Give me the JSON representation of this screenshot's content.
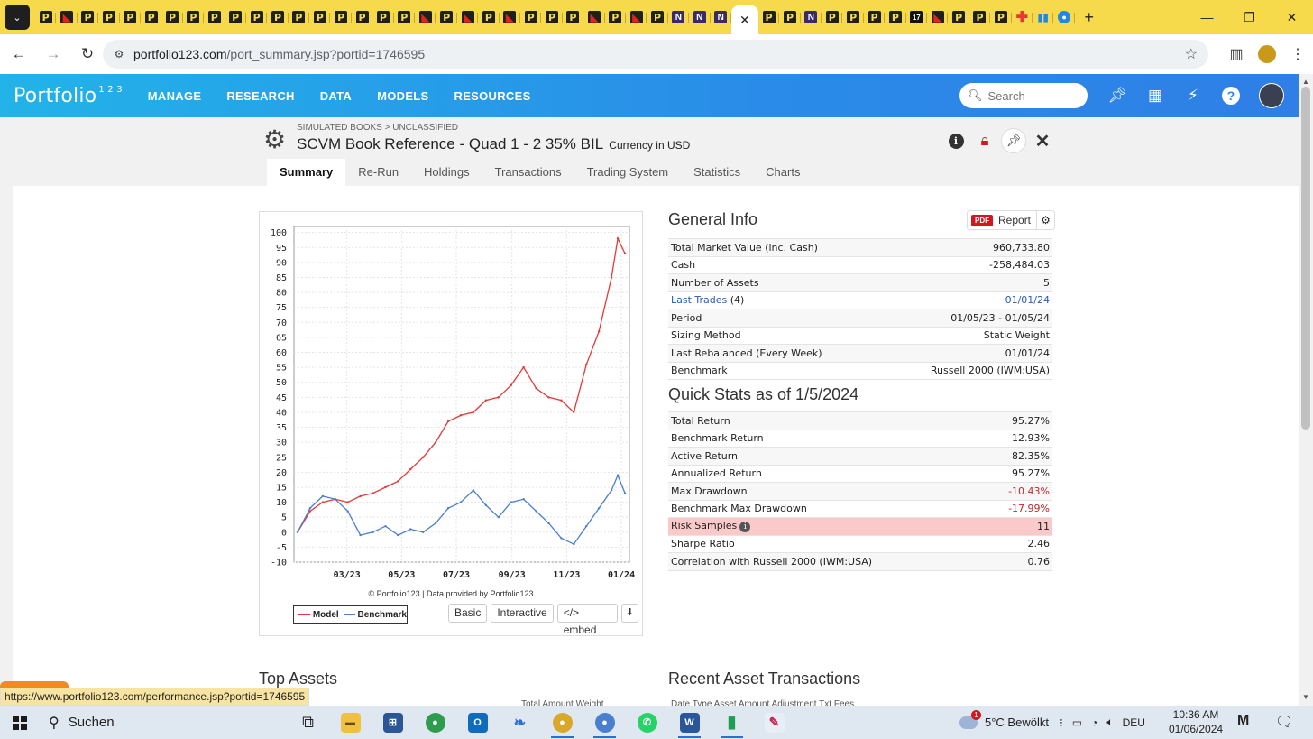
{
  "browser": {
    "tab_favicons": [
      "p",
      "red",
      "p",
      "p",
      "p",
      "p",
      "p",
      "p",
      "p",
      "p",
      "p",
      "p",
      "p",
      "p",
      "p",
      "p",
      "p",
      "p",
      "red",
      "p",
      "red",
      "p",
      "red",
      "p",
      "p",
      "p",
      "red",
      "p",
      "red",
      "p",
      "n",
      "n",
      "n",
      "active",
      "p",
      "p",
      "n",
      "p",
      "p",
      "p",
      "p",
      "17",
      "red",
      "p",
      "p",
      "p",
      "plus",
      "bars",
      "blue"
    ],
    "active_tab_close": "✕",
    "new_tab": "+",
    "url_host": "portfolio123.com",
    "url_path": "/port_summary.jsp?portid=1746595",
    "status_url": "https://www.portfolio123.com/performance.jsp?portid=1746595"
  },
  "site": {
    "logo_text": "Portfolio",
    "logo_sup": "1 2 3",
    "nav": [
      "MANAGE",
      "RESEARCH",
      "DATA",
      "MODELS",
      "RESOURCES"
    ],
    "search_placeholder": "Search"
  },
  "book": {
    "breadcrumb": "SIMULATED BOOKS > UNCLASSIFIED",
    "title": "SCVM Book Reference - Quad 1 - 2 35% BIL",
    "currency": "Currency in USD",
    "tabs": [
      "Summary",
      "Re-Run",
      "Holdings",
      "Transactions",
      "Trading System",
      "Statistics",
      "Charts"
    ],
    "active_tab": "Summary"
  },
  "chart_card": {
    "credit": "© Portfolio123 | Data provided by Portfolio123",
    "legend_model": "Model",
    "legend_benchmark": "Benchmark",
    "btn_basic": "Basic",
    "btn_interactive": "Interactive",
    "btn_embed": "</> embed"
  },
  "chart_data": {
    "type": "line",
    "x_ticks": [
      "03/23",
      "05/23",
      "07/23",
      "09/23",
      "11/23",
      "01/24"
    ],
    "y_ticks": [
      100,
      95,
      90,
      85,
      80,
      75,
      70,
      65,
      60,
      55,
      50,
      45,
      40,
      35,
      30,
      25,
      20,
      15,
      10,
      5,
      0,
      -5,
      -10
    ],
    "ylim": [
      -10,
      102
    ],
    "grid": true,
    "legend_position": "bottom-left",
    "series": [
      {
        "name": "Model",
        "color": "#e53935",
        "x": [
          "01/05/23",
          "01/19/23",
          "02/02/23",
          "02/16/23",
          "03/02/23",
          "03/16/23",
          "03/30/23",
          "04/13/23",
          "04/27/23",
          "05/11/23",
          "05/25/23",
          "06/08/23",
          "06/22/23",
          "07/06/23",
          "07/20/23",
          "08/03/23",
          "08/17/23",
          "08/31/23",
          "09/14/23",
          "09/28/23",
          "10/12/23",
          "10/26/23",
          "11/09/23",
          "11/23/23",
          "12/07/23",
          "12/21/23",
          "12/28/23",
          "01/05/24"
        ],
        "values": [
          0,
          7,
          10,
          11,
          10,
          12,
          13,
          15,
          17,
          21,
          25,
          30,
          37,
          39,
          40,
          44,
          45,
          49,
          55,
          48,
          45,
          44,
          40,
          56,
          67,
          85,
          98,
          93
        ]
      },
      {
        "name": "Benchmark",
        "color": "#4a7fd0",
        "x": [
          "01/05/23",
          "01/19/23",
          "02/02/23",
          "02/16/23",
          "03/02/23",
          "03/16/23",
          "03/30/23",
          "04/13/23",
          "04/27/23",
          "05/11/23",
          "05/25/23",
          "06/08/23",
          "06/22/23",
          "07/06/23",
          "07/20/23",
          "08/03/23",
          "08/17/23",
          "08/31/23",
          "09/14/23",
          "09/28/23",
          "10/12/23",
          "10/26/23",
          "11/09/23",
          "11/23/23",
          "12/07/23",
          "12/21/23",
          "12/28/23",
          "01/05/24"
        ],
        "values": [
          0,
          8,
          12,
          11,
          7,
          -1,
          0,
          2,
          -1,
          1,
          0,
          3,
          8,
          10,
          14,
          9,
          5,
          10,
          11,
          7,
          3,
          -2,
          -4,
          2,
          8,
          14,
          19,
          13
        ]
      }
    ]
  },
  "general_info": {
    "title": "General Info",
    "report_badge": "PDF",
    "report_label": "Report",
    "rows": [
      {
        "label": "Total Market Value (inc. Cash)",
        "value": "960,733.80"
      },
      {
        "label": "Cash",
        "value": "-258,484.03"
      },
      {
        "label": "Number of Assets",
        "value": "5"
      },
      {
        "label": "Last Trades",
        "label_suffix": " (4)",
        "value": "01/01/24"
      },
      {
        "label": "Period",
        "value": "01/05/23 - 01/05/24"
      },
      {
        "label": "Sizing Method",
        "value": "Static Weight"
      },
      {
        "label": "Last Rebalanced (Every Week)",
        "value": "01/01/24"
      },
      {
        "label": "Benchmark",
        "value": "Russell 2000 (IWM:USA)"
      }
    ]
  },
  "quick_stats": {
    "title": "Quick Stats as of 1/5/2024",
    "rows": [
      {
        "label": "Total Return",
        "value": "95.27%"
      },
      {
        "label": "Benchmark Return",
        "value": "12.93%"
      },
      {
        "label": "Active Return",
        "value": "82.35%"
      },
      {
        "label": "Annualized Return",
        "value": "95.27%"
      },
      {
        "label": "Max Drawdown",
        "value": "-10.43%"
      },
      {
        "label": "Benchmark Max Drawdown",
        "value": "-17.99%"
      },
      {
        "label": "Risk Samples",
        "value": "11"
      },
      {
        "label": "Sharpe Ratio",
        "value": "2.46"
      },
      {
        "label": "Correlation with Russell 2000 (IWM:USA)",
        "value": "0.76"
      }
    ]
  },
  "bottom": {
    "top_assets": "Top Assets",
    "top_assets_cols": "Total Amount     Weight",
    "recent_tx": "Recent Asset Transactions",
    "recent_tx_cols": "Date     Type   Asset                                          Amount   Adjustment   Txt Fees"
  },
  "taskbar": {
    "search_label": "Suchen",
    "weather": "5°C  Bewölkt",
    "weather_badge": "1",
    "lang": "DEU",
    "time": "10:36 AM",
    "date": "01/06/2024"
  }
}
